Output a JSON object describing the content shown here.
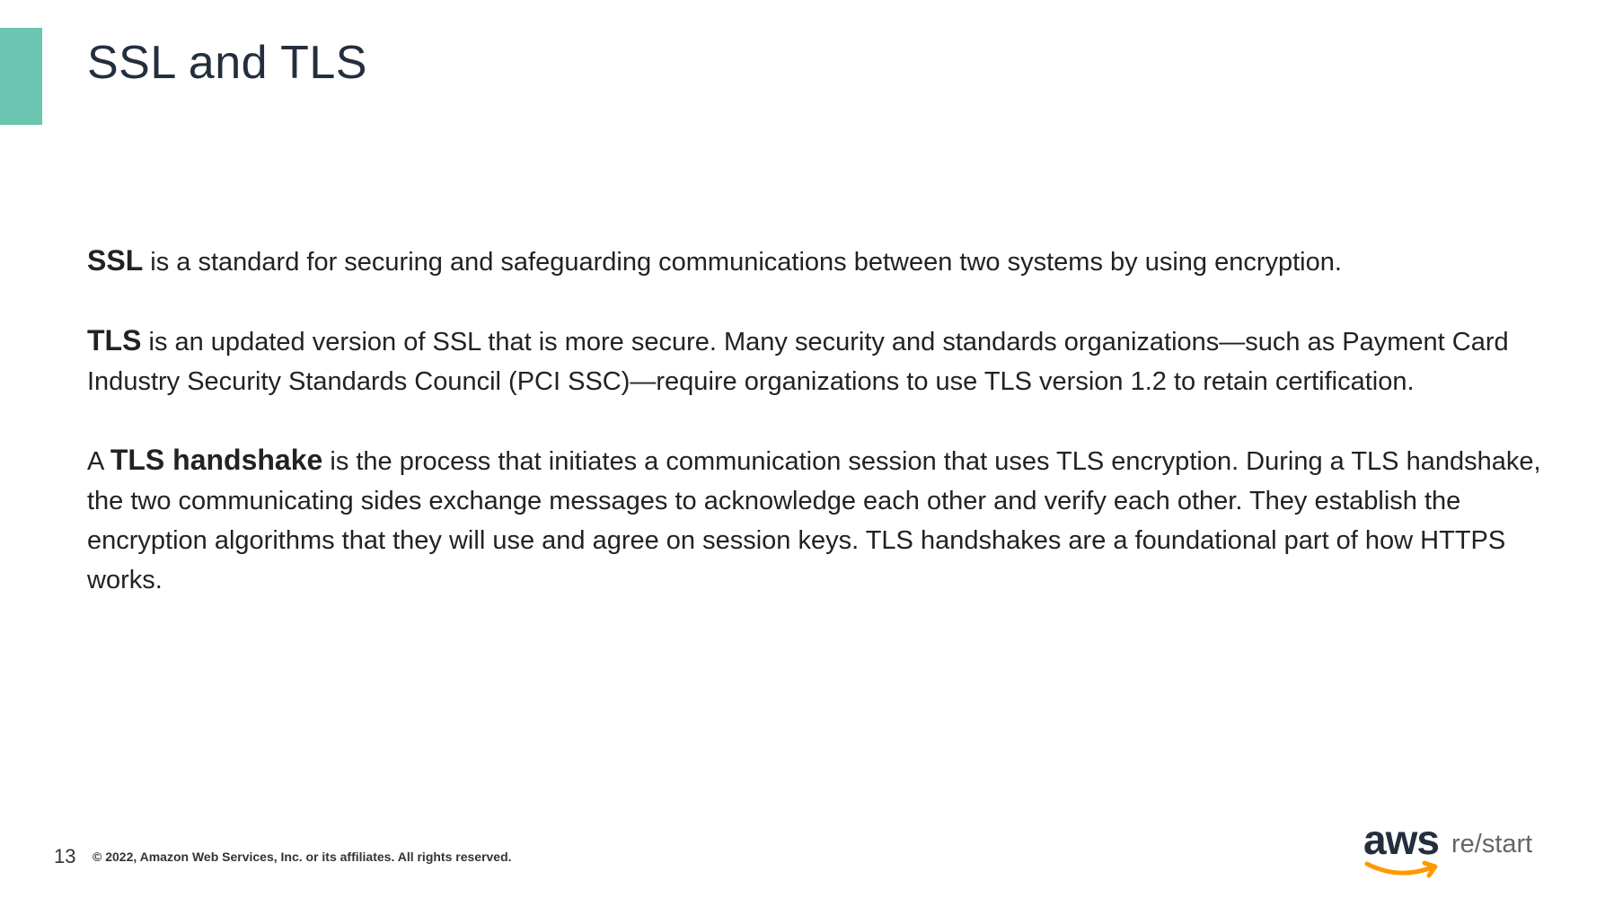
{
  "slide": {
    "title": "SSL and TLS",
    "paragraphs": {
      "p1": {
        "term": "SSL",
        "text": " is a standard for securing and safeguarding communications between two systems by using encryption."
      },
      "p2": {
        "term": "TLS",
        "text": " is an updated version of SSL that is more secure. Many security and standards organizations—such as Payment Card Industry Security Standards Council (PCI SSC)—require organizations to use TLS version 1.2 to retain certification."
      },
      "p3": {
        "prefix": "A ",
        "term": "TLS handshake",
        "text": " is the process that initiates a communication session that uses TLS encryption. During a TLS handshake, the two communicating sides exchange messages to acknowledge each other and verify each other. They establish the encryption algorithms that they will use and agree on session keys. TLS handshakes are a foundational part of how HTTPS works."
      }
    }
  },
  "footer": {
    "page_number": "13",
    "copyright": "© 2022, Amazon Web Services, Inc. or its affiliates. All rights reserved."
  },
  "logo": {
    "brand": "aws",
    "product": "re/start",
    "brand_color": "#232f3e",
    "smile_color": "#ff9900"
  },
  "colors": {
    "accent": "#6cc5b0",
    "title": "#232f3e"
  }
}
